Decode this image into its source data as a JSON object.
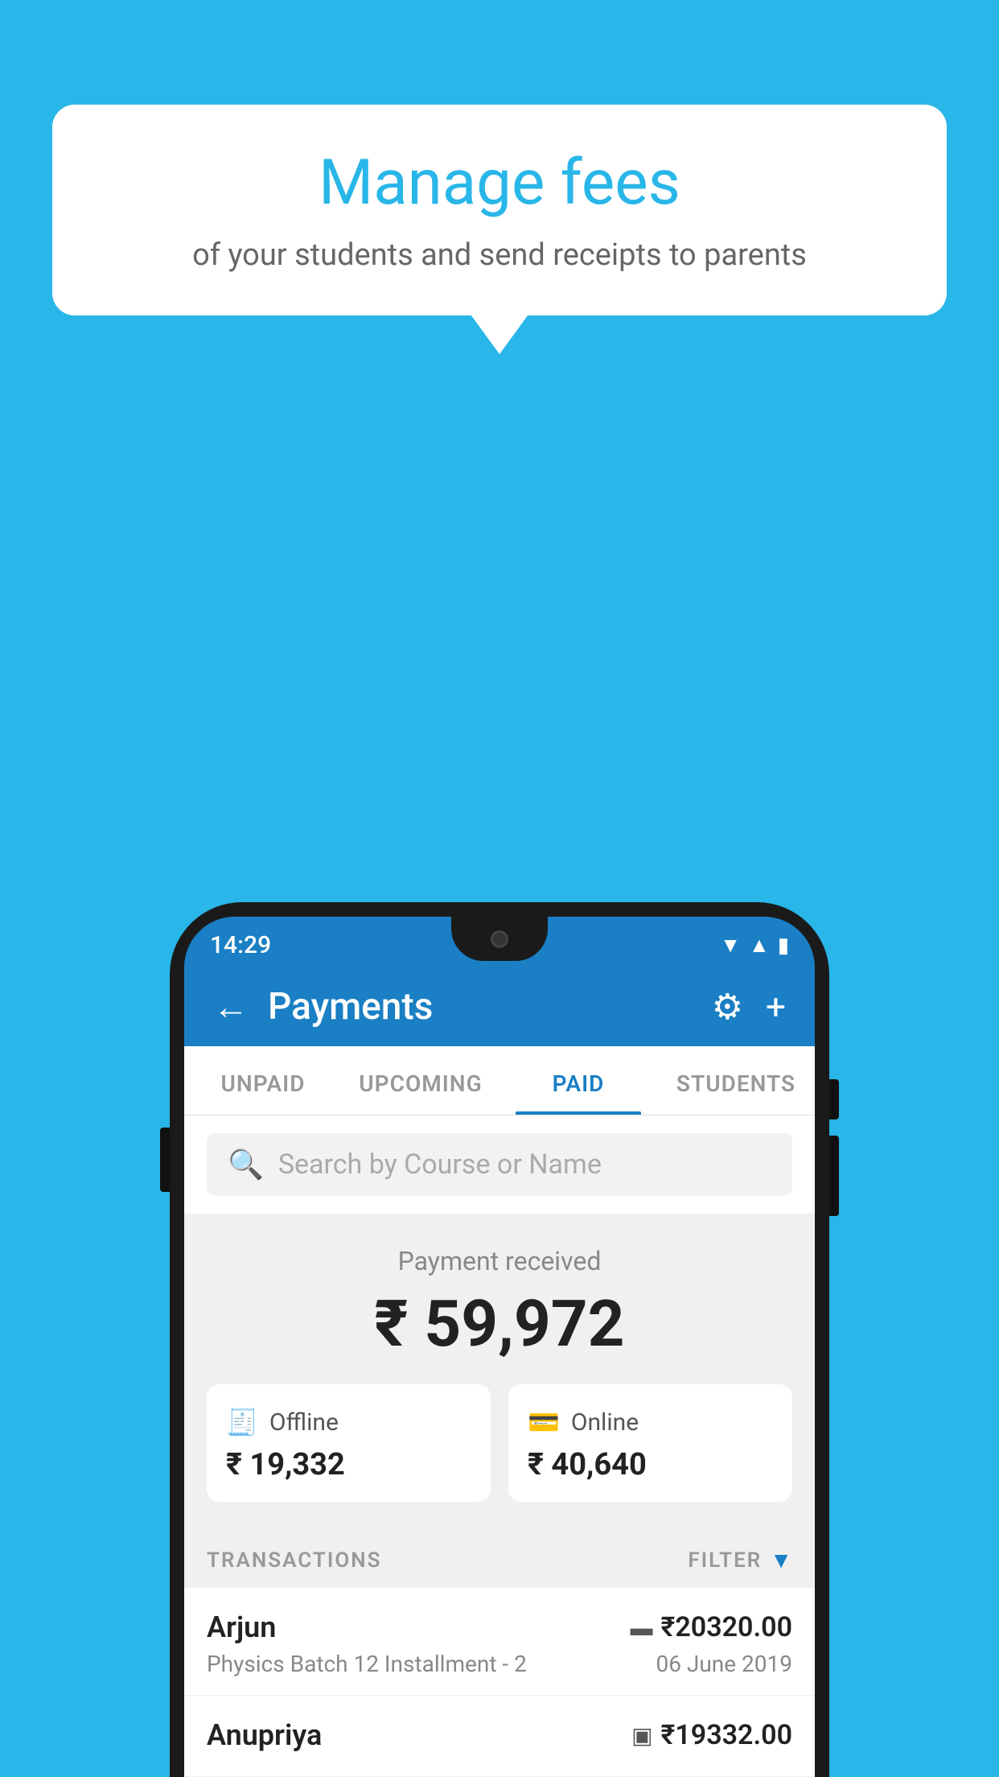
{
  "background_color": "#29b6e8",
  "bubble": {
    "title": "Manage fees",
    "subtitle": "of your students and send receipts to parents"
  },
  "status_bar": {
    "time": "14:29",
    "wifi_icon": "▼",
    "signal_icon": "▲",
    "battery_icon": "▮"
  },
  "header": {
    "back_label": "←",
    "title": "Payments",
    "settings_label": "⚙",
    "add_label": "+"
  },
  "tabs": [
    {
      "id": "unpaid",
      "label": "UNPAID",
      "active": false
    },
    {
      "id": "upcoming",
      "label": "UPCOMING",
      "active": false
    },
    {
      "id": "paid",
      "label": "PAID",
      "active": true
    },
    {
      "id": "students",
      "label": "STUDENTS",
      "active": false
    }
  ],
  "search": {
    "placeholder": "Search by Course or Name"
  },
  "payment_summary": {
    "label": "Payment received",
    "amount": "₹ 59,972",
    "offline": {
      "label": "Offline",
      "amount": "₹ 19,332"
    },
    "online": {
      "label": "Online",
      "amount": "₹ 40,640"
    }
  },
  "transactions_section": {
    "label": "TRANSACTIONS",
    "filter_label": "FILTER"
  },
  "transactions": [
    {
      "name": "Arjun",
      "type_icon": "▬",
      "amount": "₹20320.00",
      "description": "Physics Batch 12 Installment - 2",
      "date": "06 June 2019"
    },
    {
      "name": "Anupriya",
      "type_icon": "▣",
      "amount": "₹19332.00",
      "description": "",
      "date": ""
    }
  ]
}
